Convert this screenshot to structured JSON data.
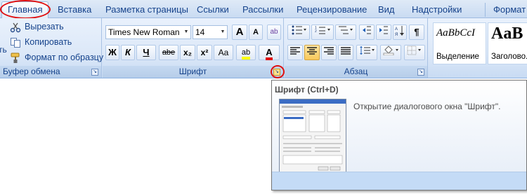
{
  "tabs": [
    "Главная",
    "Вставка",
    "Разметка страницы",
    "Ссылки",
    "Рассылки",
    "Рецензирование",
    "Вид",
    "Надстройки",
    "Формат"
  ],
  "clipboard": {
    "cut": "Вырезать",
    "copy": "Копировать",
    "format_painter": "Формат по образцу",
    "paste_fragment": "ть",
    "label": "Буфер обмена"
  },
  "font": {
    "font_name": "Times New Roman",
    "font_size": "14",
    "grow_label": "A",
    "shrink_label": "A",
    "clear_label": "ab",
    "bold": "Ж",
    "italic": "К",
    "underline": "Ч",
    "strike": "abe",
    "subscript": "x₂",
    "superscript": "x²",
    "case": "Aa",
    "highlight": "ab",
    "font_color": "A",
    "label": "Шрифт"
  },
  "paragraph": {
    "label": "Абзац",
    "pilcrow": "¶"
  },
  "styles": [
    {
      "sample": "AaBbCcI",
      "name": "Выделение"
    },
    {
      "sample": "AaB",
      "name": "Заголово..."
    }
  ],
  "tooltip": {
    "title": "Шрифт (Ctrl+D)",
    "description": "Открытие диалогового окна \"Шрифт\"."
  },
  "colors": {
    "accent_red": "#e01010",
    "ribbon_text": "#15428b",
    "highlight_yellow": "#ffff00",
    "font_color_red": "#e01010"
  }
}
